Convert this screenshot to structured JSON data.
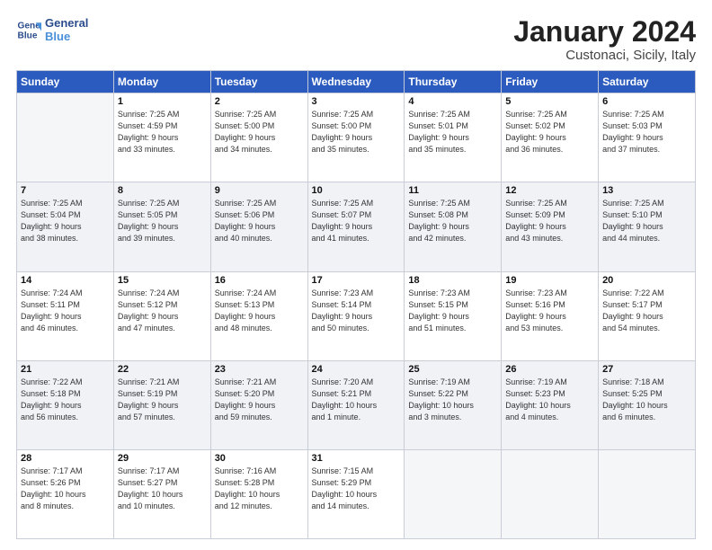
{
  "header": {
    "logo_line1": "General",
    "logo_line2": "Blue",
    "month": "January 2024",
    "location": "Custonaci, Sicily, Italy"
  },
  "weekdays": [
    "Sunday",
    "Monday",
    "Tuesday",
    "Wednesday",
    "Thursday",
    "Friday",
    "Saturday"
  ],
  "weeks": [
    [
      {
        "day": "",
        "info": ""
      },
      {
        "day": "1",
        "info": "Sunrise: 7:25 AM\nSunset: 4:59 PM\nDaylight: 9 hours\nand 33 minutes."
      },
      {
        "day": "2",
        "info": "Sunrise: 7:25 AM\nSunset: 5:00 PM\nDaylight: 9 hours\nand 34 minutes."
      },
      {
        "day": "3",
        "info": "Sunrise: 7:25 AM\nSunset: 5:00 PM\nDaylight: 9 hours\nand 35 minutes."
      },
      {
        "day": "4",
        "info": "Sunrise: 7:25 AM\nSunset: 5:01 PM\nDaylight: 9 hours\nand 35 minutes."
      },
      {
        "day": "5",
        "info": "Sunrise: 7:25 AM\nSunset: 5:02 PM\nDaylight: 9 hours\nand 36 minutes."
      },
      {
        "day": "6",
        "info": "Sunrise: 7:25 AM\nSunset: 5:03 PM\nDaylight: 9 hours\nand 37 minutes."
      }
    ],
    [
      {
        "day": "7",
        "info": "Sunrise: 7:25 AM\nSunset: 5:04 PM\nDaylight: 9 hours\nand 38 minutes."
      },
      {
        "day": "8",
        "info": "Sunrise: 7:25 AM\nSunset: 5:05 PM\nDaylight: 9 hours\nand 39 minutes."
      },
      {
        "day": "9",
        "info": "Sunrise: 7:25 AM\nSunset: 5:06 PM\nDaylight: 9 hours\nand 40 minutes."
      },
      {
        "day": "10",
        "info": "Sunrise: 7:25 AM\nSunset: 5:07 PM\nDaylight: 9 hours\nand 41 minutes."
      },
      {
        "day": "11",
        "info": "Sunrise: 7:25 AM\nSunset: 5:08 PM\nDaylight: 9 hours\nand 42 minutes."
      },
      {
        "day": "12",
        "info": "Sunrise: 7:25 AM\nSunset: 5:09 PM\nDaylight: 9 hours\nand 43 minutes."
      },
      {
        "day": "13",
        "info": "Sunrise: 7:25 AM\nSunset: 5:10 PM\nDaylight: 9 hours\nand 44 minutes."
      }
    ],
    [
      {
        "day": "14",
        "info": "Sunrise: 7:24 AM\nSunset: 5:11 PM\nDaylight: 9 hours\nand 46 minutes."
      },
      {
        "day": "15",
        "info": "Sunrise: 7:24 AM\nSunset: 5:12 PM\nDaylight: 9 hours\nand 47 minutes."
      },
      {
        "day": "16",
        "info": "Sunrise: 7:24 AM\nSunset: 5:13 PM\nDaylight: 9 hours\nand 48 minutes."
      },
      {
        "day": "17",
        "info": "Sunrise: 7:23 AM\nSunset: 5:14 PM\nDaylight: 9 hours\nand 50 minutes."
      },
      {
        "day": "18",
        "info": "Sunrise: 7:23 AM\nSunset: 5:15 PM\nDaylight: 9 hours\nand 51 minutes."
      },
      {
        "day": "19",
        "info": "Sunrise: 7:23 AM\nSunset: 5:16 PM\nDaylight: 9 hours\nand 53 minutes."
      },
      {
        "day": "20",
        "info": "Sunrise: 7:22 AM\nSunset: 5:17 PM\nDaylight: 9 hours\nand 54 minutes."
      }
    ],
    [
      {
        "day": "21",
        "info": "Sunrise: 7:22 AM\nSunset: 5:18 PM\nDaylight: 9 hours\nand 56 minutes."
      },
      {
        "day": "22",
        "info": "Sunrise: 7:21 AM\nSunset: 5:19 PM\nDaylight: 9 hours\nand 57 minutes."
      },
      {
        "day": "23",
        "info": "Sunrise: 7:21 AM\nSunset: 5:20 PM\nDaylight: 9 hours\nand 59 minutes."
      },
      {
        "day": "24",
        "info": "Sunrise: 7:20 AM\nSunset: 5:21 PM\nDaylight: 10 hours\nand 1 minute."
      },
      {
        "day": "25",
        "info": "Sunrise: 7:19 AM\nSunset: 5:22 PM\nDaylight: 10 hours\nand 3 minutes."
      },
      {
        "day": "26",
        "info": "Sunrise: 7:19 AM\nSunset: 5:23 PM\nDaylight: 10 hours\nand 4 minutes."
      },
      {
        "day": "27",
        "info": "Sunrise: 7:18 AM\nSunset: 5:25 PM\nDaylight: 10 hours\nand 6 minutes."
      }
    ],
    [
      {
        "day": "28",
        "info": "Sunrise: 7:17 AM\nSunset: 5:26 PM\nDaylight: 10 hours\nand 8 minutes."
      },
      {
        "day": "29",
        "info": "Sunrise: 7:17 AM\nSunset: 5:27 PM\nDaylight: 10 hours\nand 10 minutes."
      },
      {
        "day": "30",
        "info": "Sunrise: 7:16 AM\nSunset: 5:28 PM\nDaylight: 10 hours\nand 12 minutes."
      },
      {
        "day": "31",
        "info": "Sunrise: 7:15 AM\nSunset: 5:29 PM\nDaylight: 10 hours\nand 14 minutes."
      },
      {
        "day": "",
        "info": ""
      },
      {
        "day": "",
        "info": ""
      },
      {
        "day": "",
        "info": ""
      }
    ]
  ]
}
